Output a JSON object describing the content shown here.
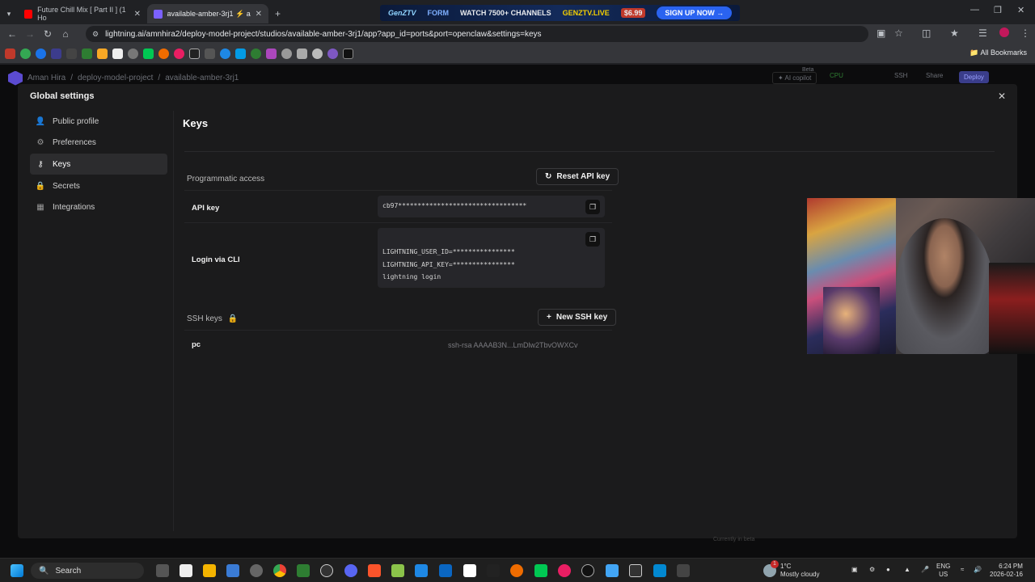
{
  "browser": {
    "tabs": [
      {
        "title": "Future Chill Mix [ Part II ] (1 Ho",
        "active": false
      },
      {
        "title": "available-amber-3rj1 ⚡ amnhi",
        "active": true
      }
    ],
    "ad": {
      "brand": "GenZTV",
      "form_text": "FORM",
      "channels": "WATCH 7500+ CHANNELS",
      "live": "GENZTV.LIVE",
      "price": "$6.99",
      "signup": "SIGN UP NOW →"
    },
    "url": "lightning.ai/amnhira2/deploy-model-project/studios/available-amber-3rj1/app?app_id=ports&port=openclaw&settings=keys",
    "all_bookmarks": "All Bookmarks"
  },
  "app": {
    "breadcrumb": [
      "Aman Hira",
      "/",
      "deploy-model-project",
      "/",
      "available-amber-3rj1"
    ],
    "ai_copilot": "AI copilot",
    "beta": "Beta",
    "cpu": "CPU",
    "ssh": "SSH",
    "share": "Share",
    "deploy": "Deploy",
    "footer_hint": "Currently in beta"
  },
  "modal": {
    "title": "Global settings",
    "nav": [
      {
        "label": "Public profile",
        "icon": "user-icon",
        "active": false
      },
      {
        "label": "Preferences",
        "icon": "gear-icon",
        "active": false
      },
      {
        "label": "Keys",
        "icon": "key-icon",
        "active": true
      },
      {
        "label": "Secrets",
        "icon": "lock-icon",
        "active": false
      },
      {
        "label": "Integrations",
        "icon": "integrations-icon",
        "active": false
      }
    ],
    "keys": {
      "heading": "Keys",
      "programmatic_access": "Programmatic access",
      "reset_button": "Reset API key",
      "api_key_label": "API key",
      "api_key_value": "cb97*********************************",
      "login_cli_label": "Login via CLI",
      "cli_lines": [
        "LIGHTNING_USER_ID=****************",
        "LIGHTNING_API_KEY=****************",
        "lightning login"
      ],
      "ssh_keys_label": "SSH keys",
      "new_ssh_button": "New SSH key",
      "ssh_name": "pc",
      "ssh_value": "ssh-rsa AAAAB3N...LmDlw2TbvOWXCv"
    }
  },
  "taskbar": {
    "search": "Search",
    "weather_temp": "1°C",
    "weather_desc": "Mostly cloudy",
    "lang": "ENG",
    "region": "US",
    "time": "6:24 PM",
    "date": "2026-02-16",
    "notif_count": "1"
  },
  "colors": {
    "accent": "#5b4bd0",
    "modal_bg": "#1b1b1c",
    "page_bg": "#0c0c0d"
  }
}
